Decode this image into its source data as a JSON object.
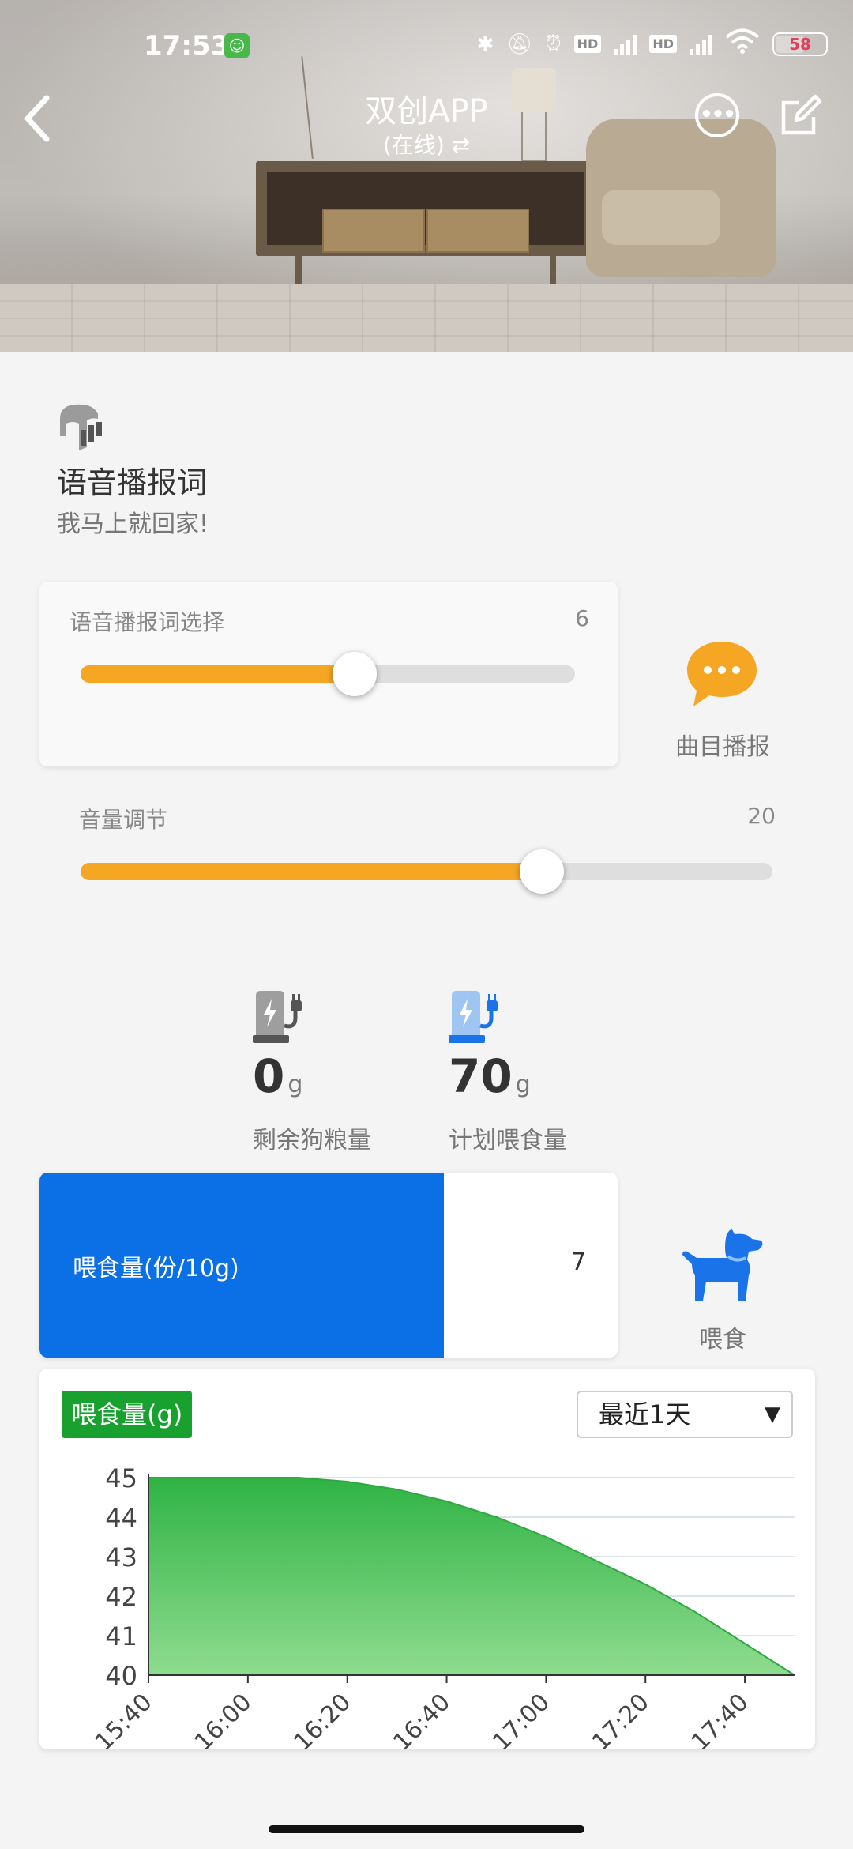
{
  "status_bar": {
    "time": "17:53",
    "battery": "58"
  },
  "header": {
    "back_icon": "chevron-left-icon",
    "title": "双创APP",
    "subtitle": "(在线) ⇄",
    "more_icon": "more-icon",
    "edit_icon": "edit-icon"
  },
  "voice": {
    "icon": "voice-broadcast-icon",
    "title": "语音播报词",
    "phrase": "我马上就回家!",
    "selector": {
      "label": "语音播报词选择",
      "value": "6",
      "fraction": 0.555
    },
    "volume": {
      "label": "音量调节",
      "value": "20",
      "fraction": 0.667
    },
    "play_button": {
      "icon": "chat-bubble-icon",
      "label": "曲目播报"
    }
  },
  "feed_stats": [
    {
      "icon": "food-station-icon",
      "value": "0",
      "unit": "g",
      "label": "剩余狗粮量"
    },
    {
      "icon": "food-station-icon",
      "value": "70",
      "unit": "g",
      "label": "计划喂食量"
    }
  ],
  "feed_amount": {
    "label": "喂食量(份/10g)",
    "value": "7",
    "fraction": 0.7
  },
  "feed_button": {
    "icon": "dog-icon",
    "label": "喂食"
  },
  "colors": {
    "accent": "#f5a623",
    "primary": "#0b6fe6",
    "chart_green": "#3cb94a",
    "badge_green": "#18a12f"
  },
  "chart_data": {
    "type": "area",
    "title": "喂食量(g)",
    "range_select": "最近1天",
    "x": [
      "15:40",
      "16:00",
      "16:20",
      "16:40",
      "17:00",
      "17:20",
      "17:40"
    ],
    "y_ticks": [
      40,
      41,
      42,
      43,
      44,
      45
    ],
    "ylim": [
      40,
      45
    ],
    "series": [
      {
        "points": [
          [
            0,
            45
          ],
          [
            0.5,
            45
          ],
          [
            1.5,
            45
          ],
          [
            2.0,
            44.9
          ],
          [
            2.5,
            44.7
          ],
          [
            3.0,
            44.4
          ],
          [
            3.5,
            44.0
          ],
          [
            4.0,
            43.5
          ],
          [
            4.5,
            42.9
          ],
          [
            5.0,
            42.3
          ],
          [
            5.5,
            41.6
          ],
          [
            6.0,
            40.8
          ],
          [
            6.5,
            40.0
          ]
        ]
      }
    ],
    "grid": true
  }
}
